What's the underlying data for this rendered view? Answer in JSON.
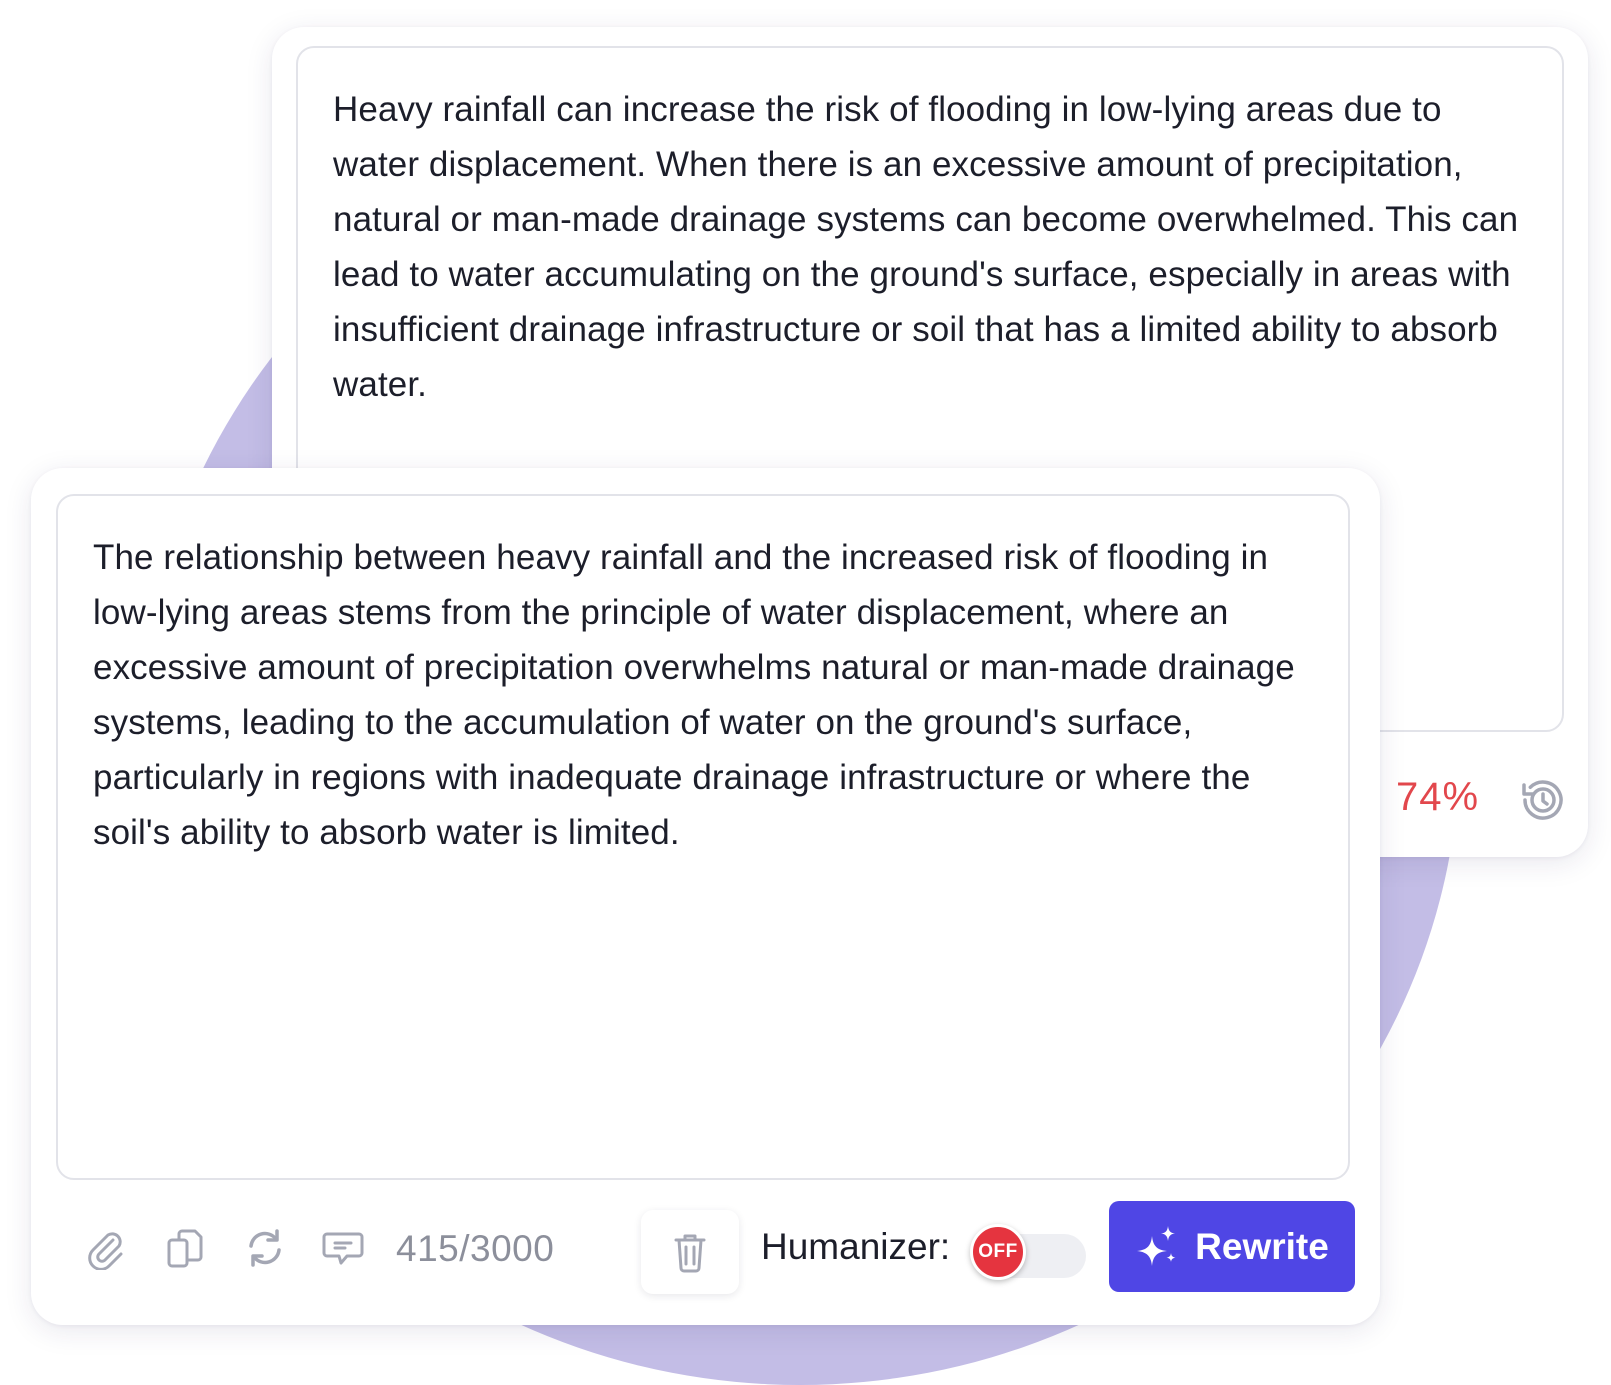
{
  "back_panel": {
    "text": "Heavy rainfall can increase the risk of flooding in low-lying areas due to water displacement. When there is an excessive amount of precipitation, natural or man-made drainage systems can become overwhelmed. This can lead to water accumulating on the ground's surface, especially in areas with insufficient drainage infrastructure or soil that has a limited ability to absorb water.",
    "score": "74%",
    "score_color": "#e2474c",
    "icons": [
      "partial-icon",
      "history-icon"
    ]
  },
  "front_panel": {
    "text": "The relationship between heavy rainfall and the increased risk of flooding in low-lying areas stems from the principle of water displacement, where an excessive amount of precipitation overwhelms natural or man-made drainage systems, leading to the accumulation of water on the ground's surface, particularly in regions with inadequate drainage infrastructure or where the soil's ability to absorb water is limited.",
    "char_count": "415/3000",
    "toolbar_icons": [
      "paperclip-icon",
      "copy-icon",
      "refresh-icon",
      "feedback-icon",
      "trash-icon"
    ],
    "humanizer_label": "Humanizer:",
    "humanizer_state": "OFF",
    "rewrite_label": "Rewrite",
    "accent_color": "#4f46e5",
    "toggle_off_color": "#e5343f"
  }
}
